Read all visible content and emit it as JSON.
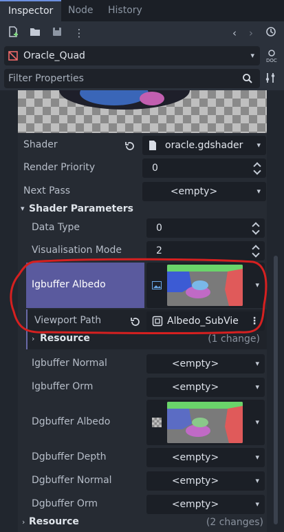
{
  "tabs": [
    "Inspector",
    "Node",
    "History"
  ],
  "node": {
    "name": "Oracle_Quad"
  },
  "filter": {
    "placeholder": "Filter Properties"
  },
  "props": {
    "shader_label": "Shader",
    "shader_value": "oracle.gdshader",
    "render_priority_label": "Render Priority",
    "render_priority_value": "0",
    "next_pass_label": "Next Pass",
    "next_pass_value": "<empty>"
  },
  "shader_params": {
    "title": "Shader Parameters",
    "data_type_label": "Data Type",
    "data_type_value": "0",
    "vis_mode_label": "Visualisation Mode",
    "vis_mode_value": "2",
    "ig_albedo_label": "Igbuffer Albedo",
    "viewport_path_label": "Viewport Path",
    "viewport_path_value": "Albedo_SubVie",
    "resource_label": "Resource",
    "resource_changes": "(1 change)",
    "ig_normal_label": "Igbuffer Normal",
    "ig_normal_value": "<empty>",
    "ig_orm_label": "Igbuffer Orm",
    "ig_orm_value": "<empty>",
    "dg_albedo_label": "Dgbuffer Albedo",
    "dg_depth_label": "Dgbuffer Depth",
    "dg_depth_value": "<empty>",
    "dg_normal_label": "Dgbuffer Normal",
    "dg_normal_value": "<empty>",
    "dg_orm_label": "Dgbuffer Orm",
    "dg_orm_value": "<empty>"
  },
  "bottom_resource": {
    "label": "Resource",
    "changes": "(2 changes)"
  },
  "colors": {
    "accent": "#6c8fe0",
    "highlight_row": "#5a5a9e",
    "annotation": "#d62020"
  }
}
